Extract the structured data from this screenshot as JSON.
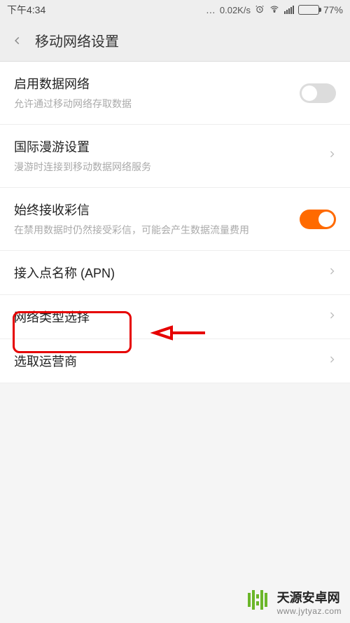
{
  "status": {
    "time": "下午4:34",
    "speed": "0.02K/s",
    "battery_pct": "77%",
    "battery_fill_width": "77%"
  },
  "header": {
    "title": "移动网络设置"
  },
  "items": {
    "data": {
      "title": "启用数据网络",
      "sub": "允许通过移动网络存取数据"
    },
    "roaming": {
      "title": "国际漫游设置",
      "sub": "漫游时连接到移动数据网络服务"
    },
    "mms": {
      "title": "始终接收彩信",
      "sub": "在禁用数据时仍然接受彩信，可能会产生数据流量费用"
    },
    "apn": {
      "title": "接入点名称 (APN)"
    },
    "nettype": {
      "title": "网络类型选择"
    },
    "carrier": {
      "title": "选取运营商"
    }
  },
  "watermark": {
    "title": "天源安卓网",
    "url": "www.jytyaz.com"
  }
}
